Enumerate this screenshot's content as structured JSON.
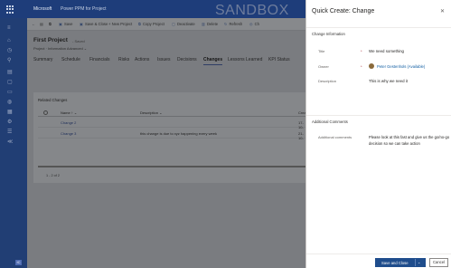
{
  "banner": {
    "brand": "Microsoft",
    "app_name": "Power PPM for Project",
    "environment_label": "SANDBOX"
  },
  "leftnav": {
    "icons": [
      "menu-icon",
      "home-icon",
      "recent-icon",
      "pin-icon",
      "chart-icon",
      "folder-icon",
      "doc-icon",
      "people-icon",
      "calendar-icon",
      "settings-icon",
      "list-icon",
      "more-icon"
    ],
    "bottom_badge": "IC"
  },
  "commands": {
    "back": "←",
    "save": "Save",
    "save_close": "Save & Close",
    "new_project": "+ New Project",
    "copy_project": "Copy Project",
    "deactivate": "Deactivate",
    "delete": "Delete",
    "refresh": "Refresh",
    "check": "Ch"
  },
  "record": {
    "title": "First Project",
    "saved_status": "- Saved",
    "subtitle": "Project · Information Advanced ⌄"
  },
  "tabs": [
    "Summary",
    "Schedule",
    "Financials",
    "Risks",
    "Actions",
    "Issues",
    "Decisions",
    "Changes",
    "Lessons Learned",
    "KPI Status"
  ],
  "active_tab": "Changes",
  "related_changes": {
    "title": "Related Changes",
    "columns": [
      "Name ↑ ⌄",
      "Description ⌄",
      "Create"
    ],
    "rows": [
      {
        "name": "Change 2",
        "description": "",
        "date": "17-10-"
      },
      {
        "name": "Change 3",
        "description": "this change is due to xyz happening every week",
        "date": "21-10-"
      }
    ],
    "pager": "1 - 2 of 2"
  },
  "quick_create": {
    "title": "Quick Create: Change",
    "close": "✕",
    "section_info": "Change Information",
    "fields": {
      "title_label": "Title",
      "title_value": "We need something",
      "owner_label": "Owner",
      "owner_value": "Peter Gestenhols (Available)",
      "description_label": "Description",
      "description_value": "This is why we need it"
    },
    "section_comments": "Additional Comments",
    "comments_label": "Additional comments",
    "comments_value": "Please look at this fast and give us the go/no-go decision so we can take action",
    "required_marker": "*",
    "save_close": "Save and Close",
    "cancel": "Cancel"
  },
  "colors": {
    "banner": "#1e3d7a",
    "primary_button": "#1f4d8c",
    "link": "#115ea3",
    "required": "#a4262c"
  }
}
